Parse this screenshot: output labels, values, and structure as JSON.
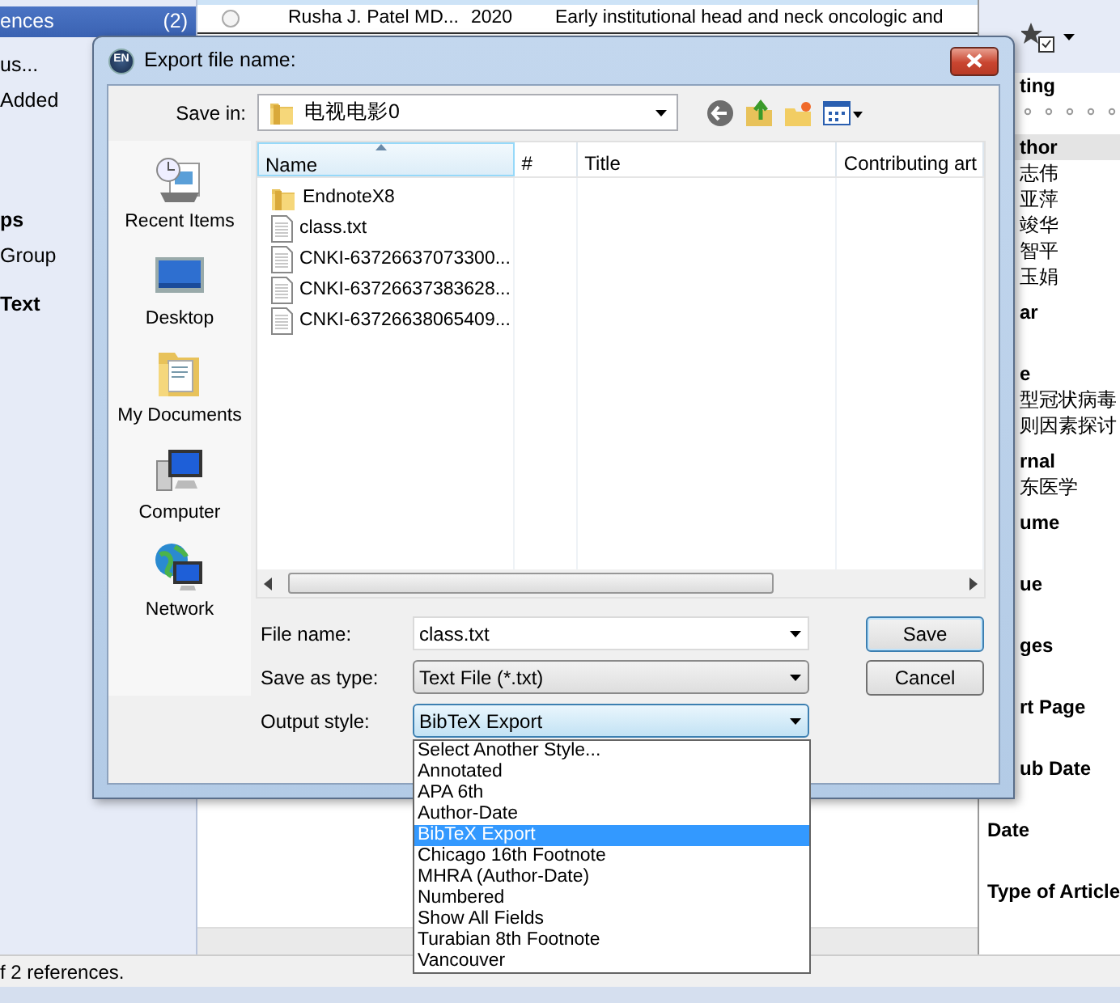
{
  "sidebar": {
    "items": [
      {
        "label": "ences",
        "count": "(2)",
        "kind": "item",
        "selected": true
      },
      {
        "label": "us...",
        "kind": "item",
        "selected": false
      },
      {
        "label": "Added",
        "kind": "item",
        "selected": false
      },
      {
        "label": "ps",
        "kind": "heading",
        "selected": false
      },
      {
        "label": "Group",
        "kind": "item",
        "selected": false
      },
      {
        "label": "Text",
        "kind": "heading",
        "selected": false
      }
    ]
  },
  "reference_row": {
    "selected": false,
    "cells": [
      "Rusha J. Patel MD...",
      "2020",
      "Early institutional head and neck oncologic and"
    ]
  },
  "detail_panel": {
    "fields": [
      {
        "label": "ting",
        "kind": "rating",
        "stars": 0
      },
      {
        "label": "thor",
        "kind": "header",
        "values": [
          "志伟",
          "亚萍",
          "竣华",
          "智平",
          "玉娟"
        ]
      },
      {
        "label": "ar",
        "kind": "field"
      },
      {
        "label": "e",
        "kind": "field",
        "values": [
          "型冠状病毒",
          "则因素探讨"
        ]
      },
      {
        "label": "rnal",
        "kind": "field",
        "values": [
          "东医学"
        ]
      },
      {
        "label": "ume",
        "kind": "field"
      },
      {
        "label": "ue",
        "kind": "field"
      },
      {
        "label": "ges",
        "kind": "field"
      },
      {
        "label": "rt Page",
        "kind": "field"
      },
      {
        "label": "ub Date",
        "kind": "field"
      },
      {
        "label": "Date",
        "kind": "field"
      },
      {
        "label": "Type of Article",
        "kind": "field"
      }
    ]
  },
  "status_bar": "f 2 references.",
  "dialog": {
    "icon_label": "EN",
    "title": "Export file name:",
    "save_in": {
      "label": "Save in:",
      "value": "电视电影0"
    },
    "places": [
      {
        "label": "Recent Items",
        "kind": "recent"
      },
      {
        "label": "Desktop",
        "kind": "desktop"
      },
      {
        "label": "My Documents",
        "kind": "documents"
      },
      {
        "label": "Computer",
        "kind": "computer"
      },
      {
        "label": "Network",
        "kind": "network"
      }
    ],
    "file_list": {
      "columns": [
        {
          "label": "Name",
          "sorted": true
        },
        {
          "label": "#",
          "sorted": false
        },
        {
          "label": "Title",
          "sorted": false
        },
        {
          "label": "Contributing art",
          "sorted": false
        }
      ],
      "rows": [
        {
          "name": "EndnoteX8",
          "kind": "folder"
        },
        {
          "name": "class.txt",
          "kind": "file"
        },
        {
          "name": "CNKI-63726637073300...",
          "kind": "file"
        },
        {
          "name": "CNKI-63726637383628...",
          "kind": "file"
        },
        {
          "name": "CNKI-63726638065409...",
          "kind": "file"
        }
      ]
    },
    "fields": [
      {
        "label": "File name:",
        "value": "class.txt",
        "kind": "editable",
        "open": false
      },
      {
        "label": "Save as type:",
        "value": "Text File (*.txt)",
        "kind": "select",
        "open": false
      },
      {
        "label": "Output style:",
        "value": "BibTeX Export",
        "kind": "select",
        "open": true,
        "options": [
          {
            "label": "Select Another Style...",
            "selected": false
          },
          {
            "label": "Annotated",
            "selected": false
          },
          {
            "label": "APA 6th",
            "selected": false
          },
          {
            "label": "Author-Date",
            "selected": false
          },
          {
            "label": "BibTeX Export",
            "selected": true
          },
          {
            "label": "Chicago 16th Footnote",
            "selected": false
          },
          {
            "label": "MHRA (Author-Date)",
            "selected": false
          },
          {
            "label": "Numbered",
            "selected": false
          },
          {
            "label": "Show All Fields",
            "selected": false
          },
          {
            "label": "Turabian 8th Footnote",
            "selected": false
          },
          {
            "label": "Vancouver",
            "selected": false
          }
        ]
      }
    ],
    "buttons": [
      {
        "label": "Save",
        "default": true
      },
      {
        "label": "Cancel",
        "default": false
      }
    ]
  }
}
